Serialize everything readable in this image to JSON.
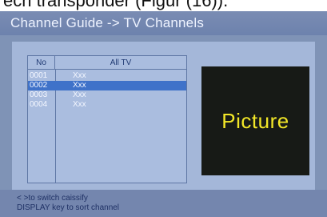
{
  "page_caption": "ech transponder (Figur (16)).",
  "title_bar": {
    "title": "Channel Guide -> TV Channels"
  },
  "channel_list": {
    "header": {
      "number_column": "No",
      "name_column": "All TV"
    },
    "rows": [
      {
        "number": "0001",
        "name": "Xxx",
        "selected": false
      },
      {
        "number": "0002",
        "name": "Xxx",
        "selected": true
      },
      {
        "number": "0003",
        "name": "Xxx",
        "selected": false
      },
      {
        "number": "0004",
        "name": "Xxx",
        "selected": false
      }
    ]
  },
  "preview": {
    "label": "Picture",
    "label_color": "#f2e728",
    "background": "#171a16"
  },
  "hints": {
    "line1": "< >to switch caissify",
    "line2": "DISPLAY key to sort channel"
  },
  "colors": {
    "screen_background": "#7f93b6",
    "panel_background": "#a4b7d9",
    "selection": "#3f72c9"
  }
}
